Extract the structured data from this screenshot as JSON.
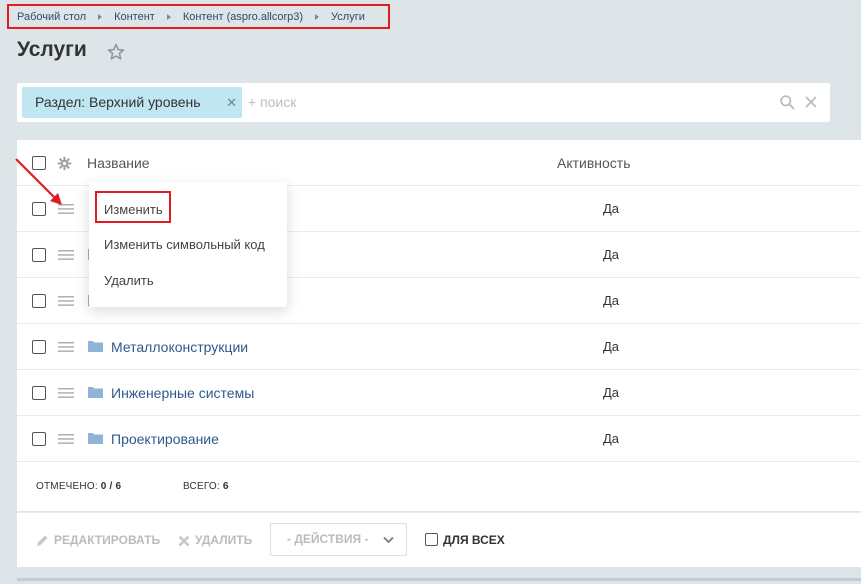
{
  "breadcrumb": {
    "items": [
      "Рабочий стол",
      "Контент",
      "Контент (aspro.allcorp3)",
      "Услуги"
    ]
  },
  "page": {
    "title": "Услуги"
  },
  "filter": {
    "chip_label": "Раздел: Верхний уровень",
    "search_placeholder": "+ поиск"
  },
  "grid": {
    "headers": {
      "name": "Название",
      "active": "Активность"
    },
    "rows": [
      {
        "name": "",
        "active": "Да"
      },
      {
        "name": "",
        "active": "Да"
      },
      {
        "name": "",
        "active": "Да"
      },
      {
        "name": "Металлоконструкции",
        "active": "Да"
      },
      {
        "name": "Инженерные системы",
        "active": "Да"
      },
      {
        "name": "Проектирование",
        "active": "Да"
      }
    ],
    "footer": {
      "selected_label": "ОТМЕЧЕНО:",
      "selected_value": "0 / 6",
      "total_label": "ВСЕГО:",
      "total_value": "6"
    }
  },
  "context_menu": {
    "items": [
      "Изменить",
      "Изменить символьный код",
      "Удалить"
    ]
  },
  "actions": {
    "edit_label": "РЕДАКТИРОВАТЬ",
    "delete_label": "УДАЛИТЬ",
    "select_label": "- ДЕЙСТВИЯ -",
    "for_all_label": "ДЛЯ ВСЕХ"
  },
  "colors": {
    "background": "#dde5e8",
    "chip_bg": "#bfe6f1",
    "link": "#2e5a8a",
    "highlight_red": "#e01b24"
  }
}
